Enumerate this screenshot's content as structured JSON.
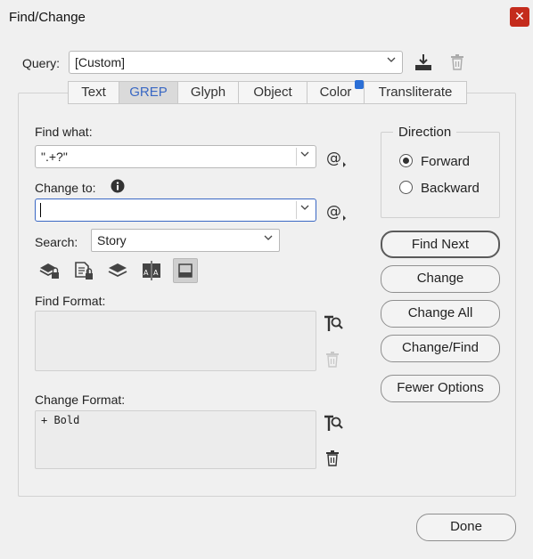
{
  "window": {
    "title": "Find/Change",
    "close_glyph": "✕"
  },
  "query": {
    "label": "Query:",
    "value": "[Custom]"
  },
  "tabs": [
    {
      "label": "Text"
    },
    {
      "label": "GREP"
    },
    {
      "label": "Glyph"
    },
    {
      "label": "Object"
    },
    {
      "label": "Color"
    },
    {
      "label": "Transliterate"
    }
  ],
  "find": {
    "label": "Find what:",
    "value": "\".+?\""
  },
  "change": {
    "label": "Change to:",
    "value": ""
  },
  "search": {
    "label": "Search:",
    "value": "Story"
  },
  "find_format": {
    "label": "Find Format:",
    "value": ""
  },
  "change_format": {
    "label": "Change Format:",
    "value": "+ Bold"
  },
  "direction": {
    "label": "Direction",
    "options": [
      {
        "label": "Forward",
        "selected": true
      },
      {
        "label": "Backward",
        "selected": false
      }
    ]
  },
  "buttons": {
    "find_next": "Find Next",
    "change": "Change",
    "change_all": "Change All",
    "change_find": "Change/Find",
    "fewer_options": "Fewer Options",
    "done": "Done"
  },
  "colors": {
    "accent": "#3a68c4",
    "close": "#c42b1c",
    "active_tab": "#dadada"
  },
  "icons": [
    "save-query-icon",
    "delete-query-icon",
    "special-characters-icon",
    "info-icon",
    "include-locked-layers-icon",
    "include-locked-stories-icon",
    "include-hidden-layers-icon",
    "include-master-pages-icon",
    "include-footnotes-icon",
    "specify-format-icon",
    "clear-format-icon"
  ]
}
